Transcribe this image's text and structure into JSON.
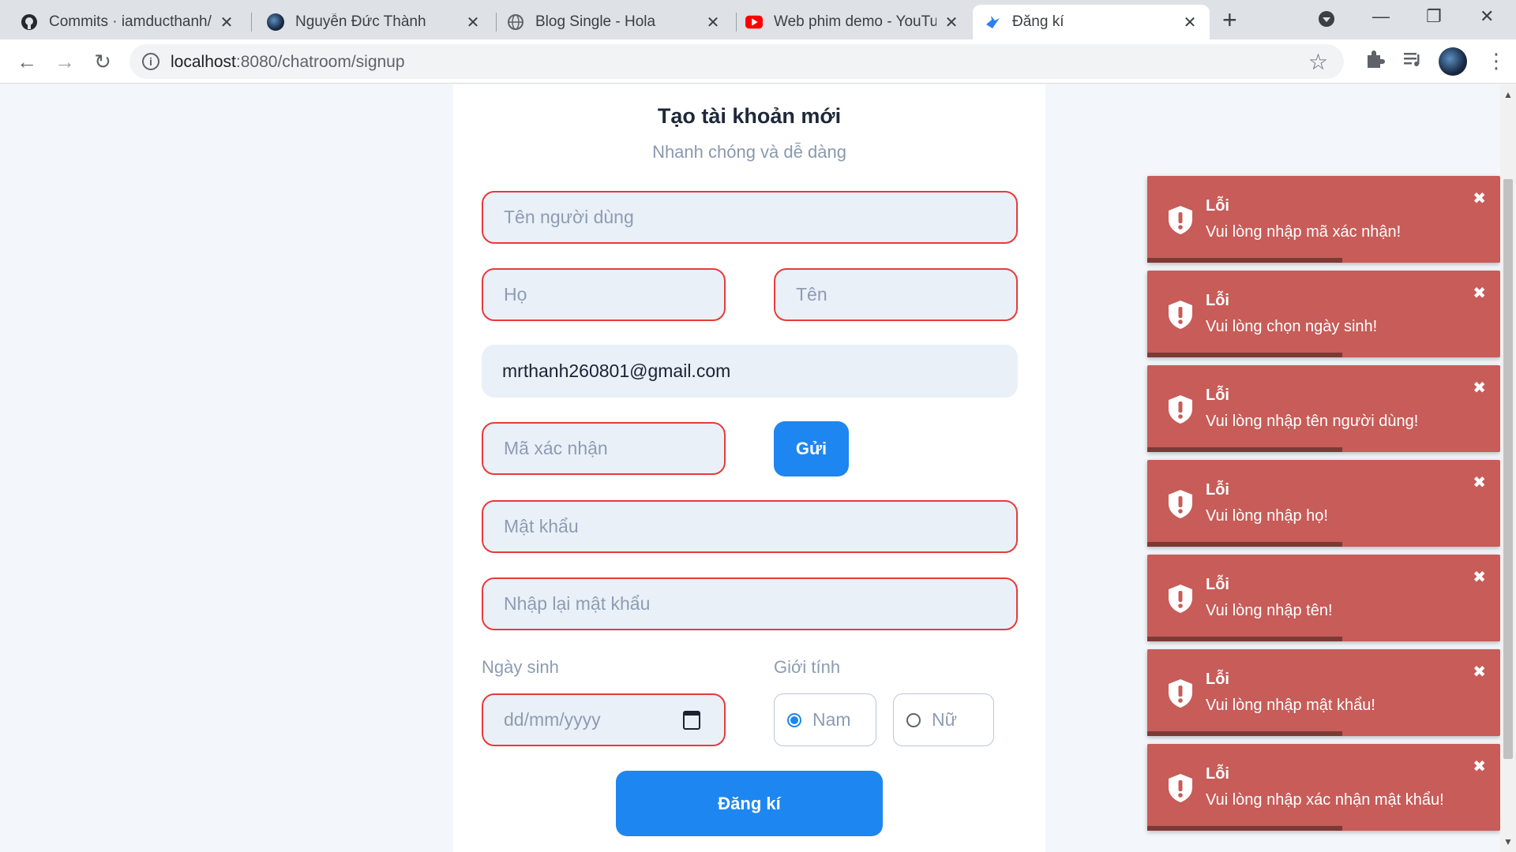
{
  "browser": {
    "tabs": [
      {
        "title": "Commits · iamducthanh/w",
        "icon": "github-icon"
      },
      {
        "title": "Nguyễn Đức Thành",
        "icon": "profile-favicon"
      },
      {
        "title": "Blog Single - Hola",
        "icon": "globe-icon"
      },
      {
        "title": "Web phim demo - YouTub",
        "icon": "youtube-icon"
      },
      {
        "title": "Đăng kí",
        "icon": "bird-icon",
        "active": true
      }
    ],
    "url_host": "localhost",
    "url_path": ":8080/chatroom/signup"
  },
  "form": {
    "title": "Tạo tài khoản mới",
    "subtitle": "Nhanh chóng và dễ dàng",
    "username_placeholder": "Tên người dùng",
    "lastname_placeholder": "Họ",
    "firstname_placeholder": "Tên",
    "email_value": "mrthanh260801@gmail.com",
    "code_placeholder": "Mã xác nhận",
    "send_label": "Gửi",
    "password_placeholder": "Mật khẩu",
    "confirm_password_placeholder": "Nhập lại mật khẩu",
    "birthday_label": "Ngày sinh",
    "birthday_placeholder": "dd/mm/yyyy",
    "gender_label": "Giới tính",
    "gender_options": [
      {
        "label": "Nam",
        "checked": true
      },
      {
        "label": "Nữ",
        "checked": false
      }
    ],
    "submit_label": "Đăng kí"
  },
  "toasts": [
    {
      "title": "Lỗi",
      "message": "Vui lòng nhập mã xác nhận!"
    },
    {
      "title": "Lỗi",
      "message": "Vui lòng chọn ngày sinh!"
    },
    {
      "title": "Lỗi",
      "message": "Vui lòng nhập tên người dùng!"
    },
    {
      "title": "Lỗi",
      "message": "Vui lòng nhập họ!"
    },
    {
      "title": "Lỗi",
      "message": "Vui lòng nhập tên!"
    },
    {
      "title": "Lỗi",
      "message": "Vui lòng nhập mật khẩu!"
    },
    {
      "title": "Lỗi",
      "message": "Vui lòng nhập xác nhận mật khẩu!"
    }
  ],
  "colors": {
    "accent": "#1e86f0",
    "error_border": "#e83a3a",
    "toast_bg": "#c75c58"
  }
}
